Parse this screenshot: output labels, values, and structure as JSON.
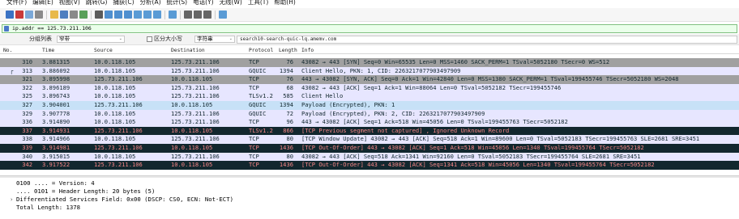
{
  "menubar": {
    "items": [
      "文件(F)",
      "编辑(E)",
      "视图(V)",
      "跳转(G)",
      "捕获(C)",
      "分析(A)",
      "统计(S)",
      "电话(Y)",
      "无线(W)",
      "工具(T)",
      "帮助(H)"
    ]
  },
  "toolbar": {
    "icons": [
      {
        "name": "shark-fin-start-icon",
        "color": "#3b73c4"
      },
      {
        "name": "stop-capture-icon",
        "color": "#c93a3a"
      },
      {
        "name": "restart-capture-icon",
        "color": "#7aa8d8"
      },
      {
        "name": "capture-options-icon",
        "color": "#8a8a8a"
      },
      {
        "name": "open-file-icon",
        "color": "#e8b94a"
      },
      {
        "name": "save-file-icon",
        "color": "#4f7fc0"
      },
      {
        "name": "close-file-icon",
        "color": "#8a8a8a"
      },
      {
        "name": "reload-icon",
        "color": "#5aa05a"
      },
      {
        "name": "find-packet-icon",
        "color": "#5b5b5b"
      },
      {
        "name": "go-back-icon",
        "color": "#4f8fcf"
      },
      {
        "name": "go-forward-icon",
        "color": "#4f8fcf"
      },
      {
        "name": "go-to-packet-icon",
        "color": "#4f8fcf"
      },
      {
        "name": "go-first-icon",
        "color": "#5a9bd5"
      },
      {
        "name": "go-last-icon",
        "color": "#5a9bd5"
      },
      {
        "name": "auto-scroll-icon",
        "color": "#5a9bd5"
      },
      {
        "name": "colorize-icon",
        "color": "#5a9bd5"
      },
      {
        "name": "zoom-in-icon",
        "color": "#666666"
      },
      {
        "name": "zoom-out-icon",
        "color": "#666666"
      },
      {
        "name": "zoom-normal-icon",
        "color": "#666666"
      },
      {
        "name": "resize-columns-icon",
        "color": "#5a9bd5"
      }
    ]
  },
  "filter": {
    "value": "ip.addr == 125.73.211.106"
  },
  "columnbar": {
    "group_label": "分组列表",
    "dropdown1": "窄带",
    "checkbox_label": "区分大小写",
    "dropdown2": "字符串",
    "search_value": "search10-search-quic-lq.amemv.com"
  },
  "columns": [
    "No.",
    "Time",
    "Source",
    "Destination",
    "Protocol",
    "Length",
    "Info"
  ],
  "packets": [
    {
      "no": "310",
      "time": "3.881315",
      "src": "10.0.118.105",
      "dst": "125.73.211.106",
      "proto": "TCP",
      "len": "76",
      "info": "43082 → 443 [SYN] Seq=0 Win=65535 Len=0 MSS=1460 SACK_PERM=1 TSval=5052180 TSecr=0 WS=512",
      "style": "gray",
      "mark": ""
    },
    {
      "no": "313",
      "time": "3.886092",
      "src": "10.0.118.105",
      "dst": "125.73.211.106",
      "proto": "GQUIC",
      "len": "1394",
      "info": "Client Hello, PKN: 1, CID: 2263217077903497909",
      "style": "lavender",
      "mark": "┌"
    },
    {
      "no": "321",
      "time": "3.895998",
      "src": "125.73.211.106",
      "dst": "10.0.118.105",
      "proto": "TCP",
      "len": "76",
      "info": "443 → 43082 [SYN, ACK] Seq=0 Ack=1 Win=42840 Len=0 MSS=1380 SACK_PERM=1 TSval=199455746 TSecr=5052180 WS=2048",
      "style": "gray",
      "mark": ""
    },
    {
      "no": "322",
      "time": "3.896189",
      "src": "10.0.118.105",
      "dst": "125.73.211.106",
      "proto": "TCP",
      "len": "68",
      "info": "43082 → 443 [ACK] Seq=1 Ack=1 Win=88064 Len=0 TSval=5052182 TSecr=199455746",
      "style": "lavender",
      "mark": ""
    },
    {
      "no": "325",
      "time": "3.896743",
      "src": "10.0.118.105",
      "dst": "125.73.211.106",
      "proto": "TLSv1.2",
      "len": "585",
      "info": "Client Hello",
      "style": "lavender",
      "mark": ""
    },
    {
      "no": "327",
      "time": "3.904001",
      "src": "125.73.211.106",
      "dst": "10.0.118.105",
      "proto": "GQUIC",
      "len": "1394",
      "info": "Payload (Encrypted), PKN: 1",
      "style": "selected",
      "mark": ""
    },
    {
      "no": "329",
      "time": "3.907778",
      "src": "10.0.118.105",
      "dst": "125.73.211.106",
      "proto": "GQUIC",
      "len": "72",
      "info": "Payload (Encrypted), PKN: 2, CID: 2263217077903497909",
      "style": "lavender",
      "mark": ""
    },
    {
      "no": "336",
      "time": "3.914890",
      "src": "10.0.118.105",
      "dst": "125.73.211.106",
      "proto": "TCP",
      "len": "96",
      "info": "443 → 43082 [ACK] Seq=1 Ack=518 Win=45056 Len=0 TSval=199455763 TSecr=5052182",
      "style": "lavender",
      "mark": ""
    },
    {
      "no": "337",
      "time": "3.914931",
      "src": "125.73.211.106",
      "dst": "10.0.118.105",
      "proto": "TLSv1.2",
      "len": "866",
      "info": "[TCP Previous segment not captured] , Ignored Unknown Record",
      "style": "black",
      "mark": ""
    },
    {
      "no": "338",
      "time": "3.914966",
      "src": "10.0.118.105",
      "dst": "125.73.211.106",
      "proto": "TCP",
      "len": "80",
      "info": "[TCP Window Update] 43082 → 443 [ACK] Seq=518 Ack=1 Win=89600 Len=0 TSval=5052183 TSecr=199455763 SLE=2681 SRE=3451",
      "style": "lavender",
      "mark": ""
    },
    {
      "no": "339",
      "time": "3.914981",
      "src": "125.73.211.106",
      "dst": "10.0.118.105",
      "proto": "TCP",
      "len": "1436",
      "info": "[TCP Out-Of-Order] 443 → 43082 [ACK] Seq=1 Ack=518 Win=45056 Len=1340 TSval=199455764 TSecr=5052182",
      "style": "black",
      "mark": ""
    },
    {
      "no": "340",
      "time": "3.915015",
      "src": "10.0.118.105",
      "dst": "125.73.211.106",
      "proto": "TCP",
      "len": "80",
      "info": "43082 → 443 [ACK] Seq=518 Ack=1341 Win=92160 Len=0 TSval=5052183 TSecr=199455764 SLE=2681 SRE=3451",
      "style": "lavender",
      "mark": ""
    },
    {
      "no": "342",
      "time": "3.917522",
      "src": "125.73.211.106",
      "dst": "10.0.118.105",
      "proto": "TCP",
      "len": "1436",
      "info": "[TCP Out-Of-Order] 443 → 43082 [ACK] Seq=1341 Ack=518 Win=45056 Len=1340 TSval=199455764 TSecr=5052182",
      "style": "black",
      "mark": ""
    }
  ],
  "details": {
    "lines": [
      {
        "text": "0100 .... = Version: 4",
        "arrow": ""
      },
      {
        "text": ".... 0101 = Header Length: 20 bytes (5)",
        "arrow": ""
      },
      {
        "text": "Differentiated Services Field: 0x00 (DSCP: CS0, ECN: Not-ECT)",
        "arrow": "›"
      },
      {
        "text": "Total Length: 1378",
        "arrow": ""
      }
    ]
  }
}
